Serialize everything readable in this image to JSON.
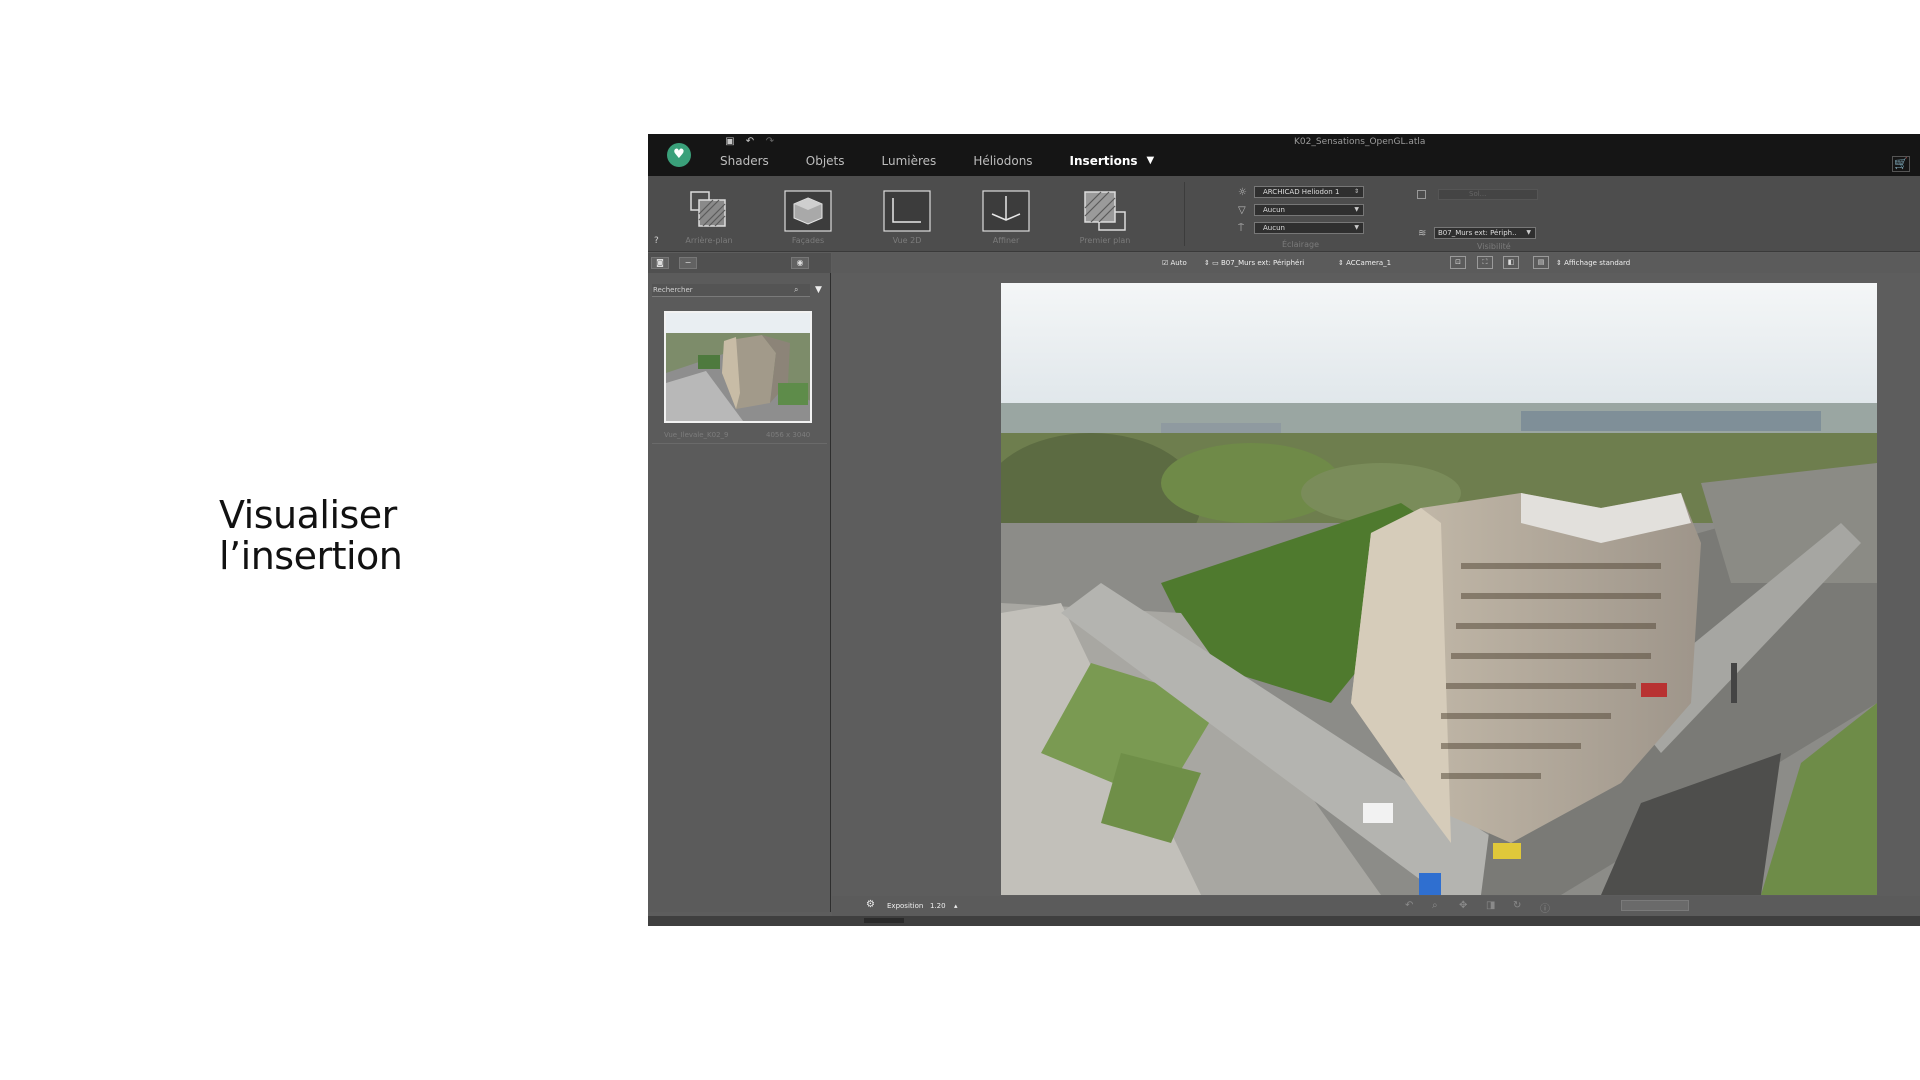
{
  "slide": {
    "headline_line1": "Visualiser",
    "headline_line2": "l’insertion"
  },
  "window": {
    "title": "K02_Sensations_OpenGL.atla"
  },
  "menu": {
    "items": [
      {
        "label": "Shaders"
      },
      {
        "label": "Objets"
      },
      {
        "label": "Lumières"
      },
      {
        "label": "Héliodons"
      },
      {
        "label": "Insertions",
        "active": true
      }
    ]
  },
  "ribbon": {
    "tools": [
      {
        "label": "Arrière-plan",
        "icon": "background-plane-icon"
      },
      {
        "label": "Façades",
        "icon": "facade-icon"
      },
      {
        "label": "Vue 2D",
        "icon": "view-2d-icon"
      },
      {
        "label": "Affiner",
        "icon": "refine-icon"
      },
      {
        "label": "Premier plan",
        "icon": "foreground-plane-icon"
      }
    ],
    "help": "?",
    "lighting": {
      "heliodon": "ARCHICAD Heliodon 1",
      "combo2": "Aucun",
      "combo3": "Aucun",
      "group_label": "Éclairage"
    },
    "visibility": {
      "disabled_field": "Sol...",
      "layer": "B07_Murs ext: Périph..",
      "group_label": "Visibilité"
    }
  },
  "left_panel": {
    "search_placeholder": "Rechercher",
    "thumbnail_caption": "Vue_Ilevale_K02_9",
    "thumbnail_size": "4056 x 3040"
  },
  "viewport_bar": {
    "auto_label": "Auto",
    "layer_label": "B07_Murs ext: Périphéri",
    "camera_label": "ACCamera_1",
    "display_label": "Affichage standard"
  },
  "status_bar": {
    "exposure_label": "Exposition",
    "exposure_value": "1.20"
  },
  "colors": {
    "app_bg": "#5d5d5d",
    "titlebar": "#151515",
    "ribbon": "#4d4d4d",
    "accent_logo": "#3aa07a"
  }
}
